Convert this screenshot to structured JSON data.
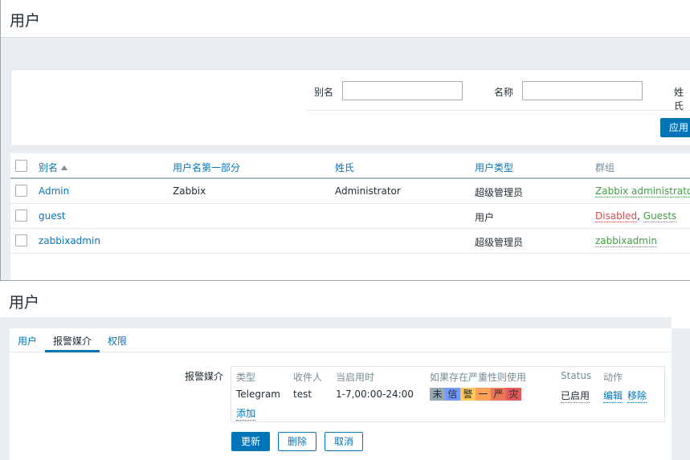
{
  "upper": {
    "title": "用户",
    "filter": {
      "alias_label": "别名",
      "name_label": "名称",
      "surname_label": "姓氏",
      "alias_value": "",
      "name_value": "",
      "apply_label": "应用"
    },
    "table": {
      "headers": [
        "别名",
        "用户名第一部分",
        "姓氏",
        "用户类型",
        "群组"
      ],
      "rows": [
        {
          "alias": "Admin",
          "name": "Zabbix",
          "surname": "Administrator",
          "type": "超级管理员",
          "groups": [
            "Zabbix administrators"
          ]
        },
        {
          "alias": "guest",
          "name": "",
          "surname": "",
          "type": "用户",
          "groups_disabled": "Disabled",
          "groups_sep": ", ",
          "groups": [
            "Guests"
          ]
        },
        {
          "alias": "zabbixadmin",
          "name": "",
          "surname": "",
          "type": "超级管理员",
          "groups": [
            "zabbixadmin"
          ]
        }
      ]
    }
  },
  "lower": {
    "title": "用户",
    "tabs": [
      "用户",
      "报警媒介",
      "权限"
    ],
    "active_tab": "报警媒介",
    "media_label": "报警媒介",
    "media_headers": [
      "类型",
      "收件人",
      "当启用时",
      "如果存在严重性则使用",
      "Status",
      "动作"
    ],
    "media_row": {
      "type": "Telegram",
      "sendto": "test",
      "when_active": "1-7,00:00-24:00",
      "severities": [
        {
          "label": "未",
          "color": "#97aab3"
        },
        {
          "label": "信",
          "color": "#7499ff"
        },
        {
          "label": "警",
          "color": "#ffc859"
        },
        {
          "label": "一",
          "color": "#ffa059"
        },
        {
          "label": "严",
          "color": "#e97659"
        },
        {
          "label": "灾",
          "color": "#e45959"
        }
      ],
      "status": "已启用",
      "edit": "编辑",
      "remove": "移除"
    },
    "add_label": "添加",
    "buttons": {
      "update": "更新",
      "delete": "删除",
      "cancel": "取消"
    }
  }
}
